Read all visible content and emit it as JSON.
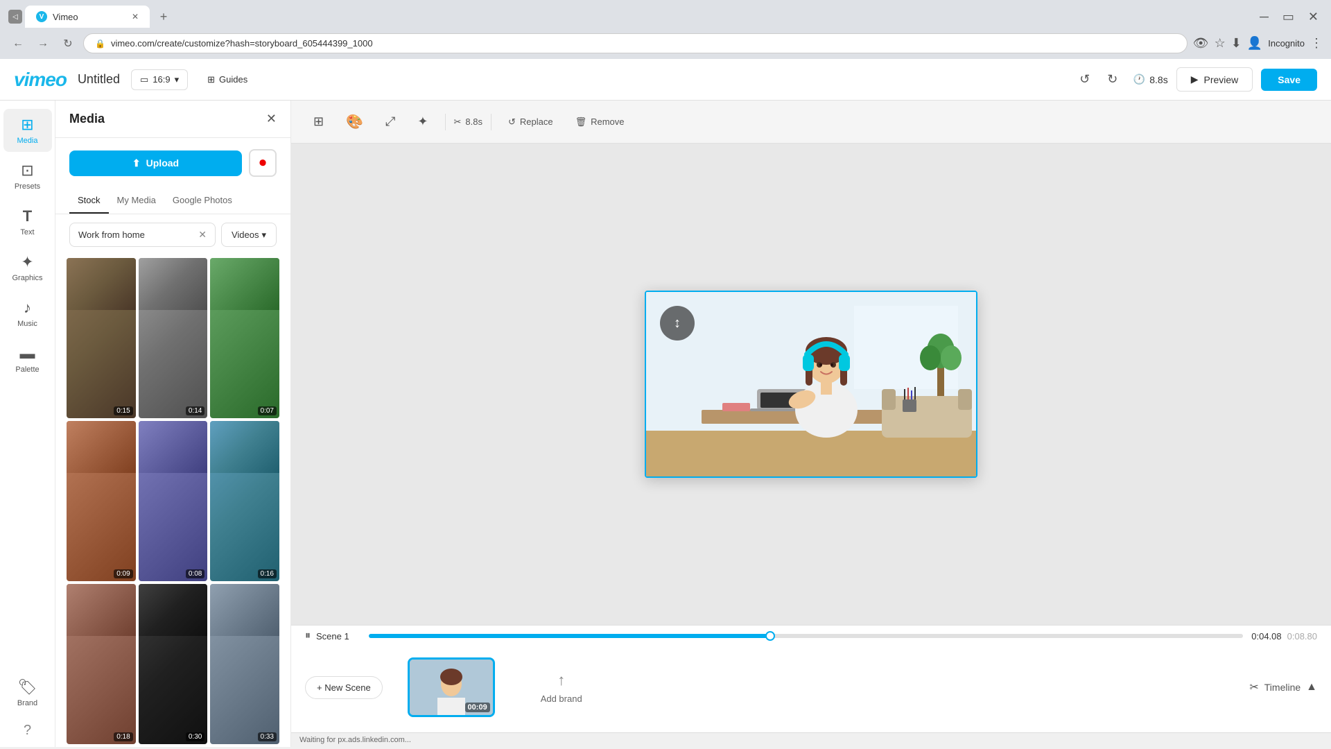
{
  "browser": {
    "tab_title": "Vimeo",
    "url": "vimeo.com/create/customize?hash=storyboard_605444399_1000",
    "new_tab_label": "+",
    "incognito_label": "Incognito"
  },
  "app_header": {
    "logo": "vimeo",
    "project_title": "Untitled",
    "aspect_ratio": "16:9",
    "guides_label": "Guides",
    "duration": "8.8s",
    "preview_label": "Preview",
    "save_label": "Save"
  },
  "sidebar": {
    "items": [
      {
        "id": "media",
        "label": "Media",
        "icon": "⊞",
        "active": true
      },
      {
        "id": "presets",
        "label": "Presets",
        "icon": "⊡"
      },
      {
        "id": "text",
        "label": "Text",
        "icon": "T"
      },
      {
        "id": "graphics",
        "label": "Graphics",
        "icon": "✦"
      },
      {
        "id": "music",
        "label": "Music",
        "icon": "♪"
      },
      {
        "id": "palette",
        "label": "Palette",
        "icon": "▬"
      },
      {
        "id": "brand",
        "label": "Brand",
        "icon": "🏷"
      }
    ]
  },
  "media_panel": {
    "title": "Media",
    "upload_label": "Upload",
    "tabs": [
      "Stock",
      "My Media",
      "Google Photos"
    ],
    "active_tab": "Stock",
    "search_value": "Work from home",
    "filter_label": "Videos",
    "thumbnails": [
      {
        "duration": "0:15",
        "class": "thumb-1"
      },
      {
        "duration": "0:14",
        "class": "thumb-2"
      },
      {
        "duration": "0:07",
        "class": "thumb-3"
      },
      {
        "duration": "0:09",
        "class": "thumb-4"
      },
      {
        "duration": "0:08",
        "class": "thumb-5"
      },
      {
        "duration": "0:16",
        "class": "thumb-6"
      },
      {
        "duration": "0:18",
        "class": "thumb-7"
      },
      {
        "duration": "0:30",
        "class": "thumb-8"
      },
      {
        "duration": "0:33",
        "class": "thumb-9"
      }
    ]
  },
  "canvas": {
    "toolbar": {
      "grid_label": "",
      "color_label": "",
      "expand_label": "",
      "effects_label": "",
      "duration": "8.8s",
      "replace_label": "Replace",
      "remove_label": "Remove"
    }
  },
  "timeline": {
    "new_scene_label": "+ New Scene",
    "timeline_label": "Timeline",
    "scene_label": "Scene 1",
    "scene_duration": "00:09",
    "add_brand_label": "Add brand",
    "progress_current": "0:04.08",
    "progress_total": "0:08.80",
    "progress_percent": 46
  },
  "status_bar": {
    "text": "Waiting for px.ads.linkedin.com..."
  }
}
